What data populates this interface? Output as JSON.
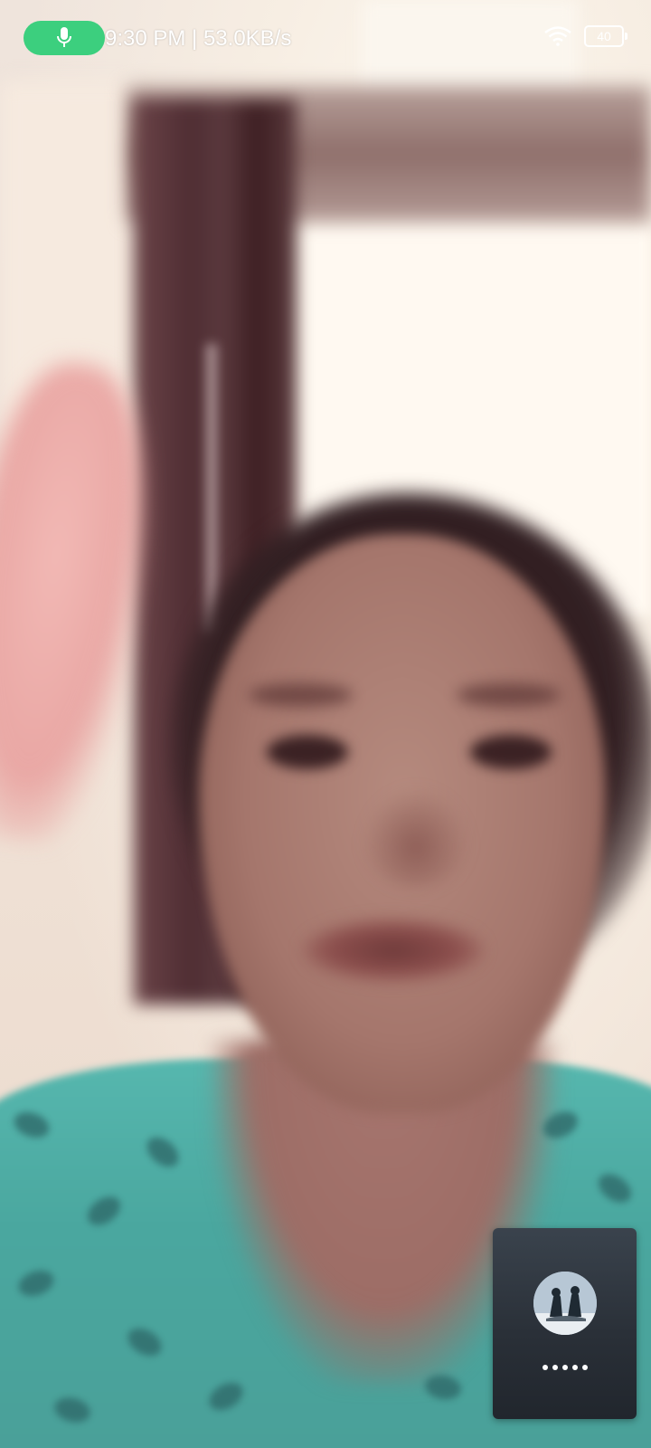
{
  "status_bar": {
    "time_and_speed": "9:30 PM | 53.0KB/s",
    "battery_level": "40",
    "icons": [
      "microphone-icon",
      "wifi-icon",
      "battery-icon"
    ],
    "call_chip_color": "#3ccf7e"
  },
  "remote_video": {
    "state": "active"
  },
  "self_view": {
    "avatar_icon": "avatar-icon",
    "loading_dots": 5
  }
}
